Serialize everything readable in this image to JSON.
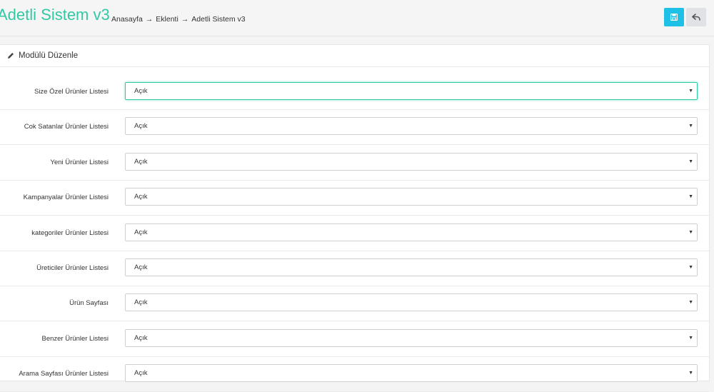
{
  "header": {
    "title": "Adetli Sistem v3",
    "breadcrumb": [
      "Anasayfa",
      "Eklenti",
      "Adetli Sistem v3"
    ],
    "breadcrumb_separator": "→",
    "save_icon": "save-icon",
    "back_icon": "reply-icon",
    "accent_color": "#33c8a4",
    "save_button_color": "#1ec0e6"
  },
  "panel": {
    "heading": "Modülü Düzenle",
    "heading_icon": "pencil-icon"
  },
  "form": {
    "rows": [
      {
        "label": "Size Özel Ürünler Listesi",
        "value": "Açık"
      },
      {
        "label": "Cok Satanlar Ürünler Listesi",
        "value": "Açık"
      },
      {
        "label": "Yeni Ürünler Listesi",
        "value": "Açık"
      },
      {
        "label": "Kampanyalar Ürünler Listesi",
        "value": "Açık"
      },
      {
        "label": "kategoriler Ürünler Listesi",
        "value": "Açık"
      },
      {
        "label": "Üreticiler Ürünler Listesi",
        "value": "Açık"
      },
      {
        "label": "Ürün Sayfası",
        "value": "Açık"
      },
      {
        "label": "Benzer Ürünler Listesi",
        "value": "Açık"
      },
      {
        "label": "Arama Sayfası Ürünler Listesi",
        "value": "Açık"
      }
    ]
  }
}
